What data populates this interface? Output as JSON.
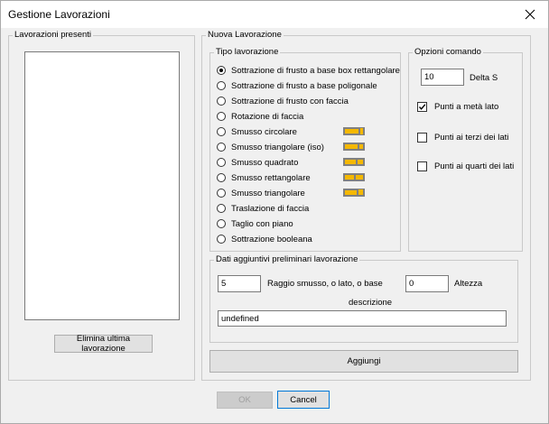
{
  "window": {
    "title": "Gestione Lavorazioni"
  },
  "left": {
    "group_label": "Lavorazioni presenti",
    "items": [],
    "delete_button": "Elimina ultima lavorazione"
  },
  "nuova": {
    "group_label": "Nuova Lavorazione",
    "tipo": {
      "label": "Tipo lavorazione",
      "options": [
        {
          "label": "Sottrazione di frusto a base box rettangolare",
          "checked": true
        },
        {
          "label": "Sottrazione di frusto a base poligonale",
          "checked": false
        },
        {
          "label": "Sottrazione di frusto con faccia",
          "checked": false
        },
        {
          "label": "Rotazione di faccia",
          "checked": false
        },
        {
          "label": "Smusso circolare",
          "checked": false
        },
        {
          "label": "Smusso triangolare (iso)",
          "checked": false
        },
        {
          "label": "Smusso quadrato",
          "checked": false
        },
        {
          "label": "Smusso rettangolare",
          "checked": false
        },
        {
          "label": "Smusso triangolare",
          "checked": false
        },
        {
          "label": "Traslazione di faccia",
          "checked": false
        },
        {
          "label": "Taglio con piano",
          "checked": false
        },
        {
          "label": "Sottrazione booleana",
          "checked": false
        }
      ]
    },
    "opzioni": {
      "label": "Opzioni comando",
      "delta_value": "10",
      "delta_label": "Delta S",
      "checks": [
        {
          "label": "Punti a metà lato",
          "checked": true
        },
        {
          "label": "Punti ai terzi dei lati",
          "checked": false
        },
        {
          "label": "Punti ai quarti dei lati",
          "checked": false
        }
      ]
    },
    "dati": {
      "label": "Dati aggiuntivi  preliminari lavorazione",
      "raggio_value": "5",
      "raggio_label": "Raggio smusso, o lato, o base",
      "altezza_value": "0",
      "altezza_label": "Altezza",
      "descrizione_label": "descrizione",
      "descrizione_value": "undefined"
    },
    "add_button": "Aggiungi"
  },
  "footer": {
    "ok": "OK",
    "cancel": "Cancel"
  },
  "colors": {
    "accent": "#0078d7",
    "thumb_fill": "#f5b800",
    "thumb_shadow": "#808080"
  }
}
